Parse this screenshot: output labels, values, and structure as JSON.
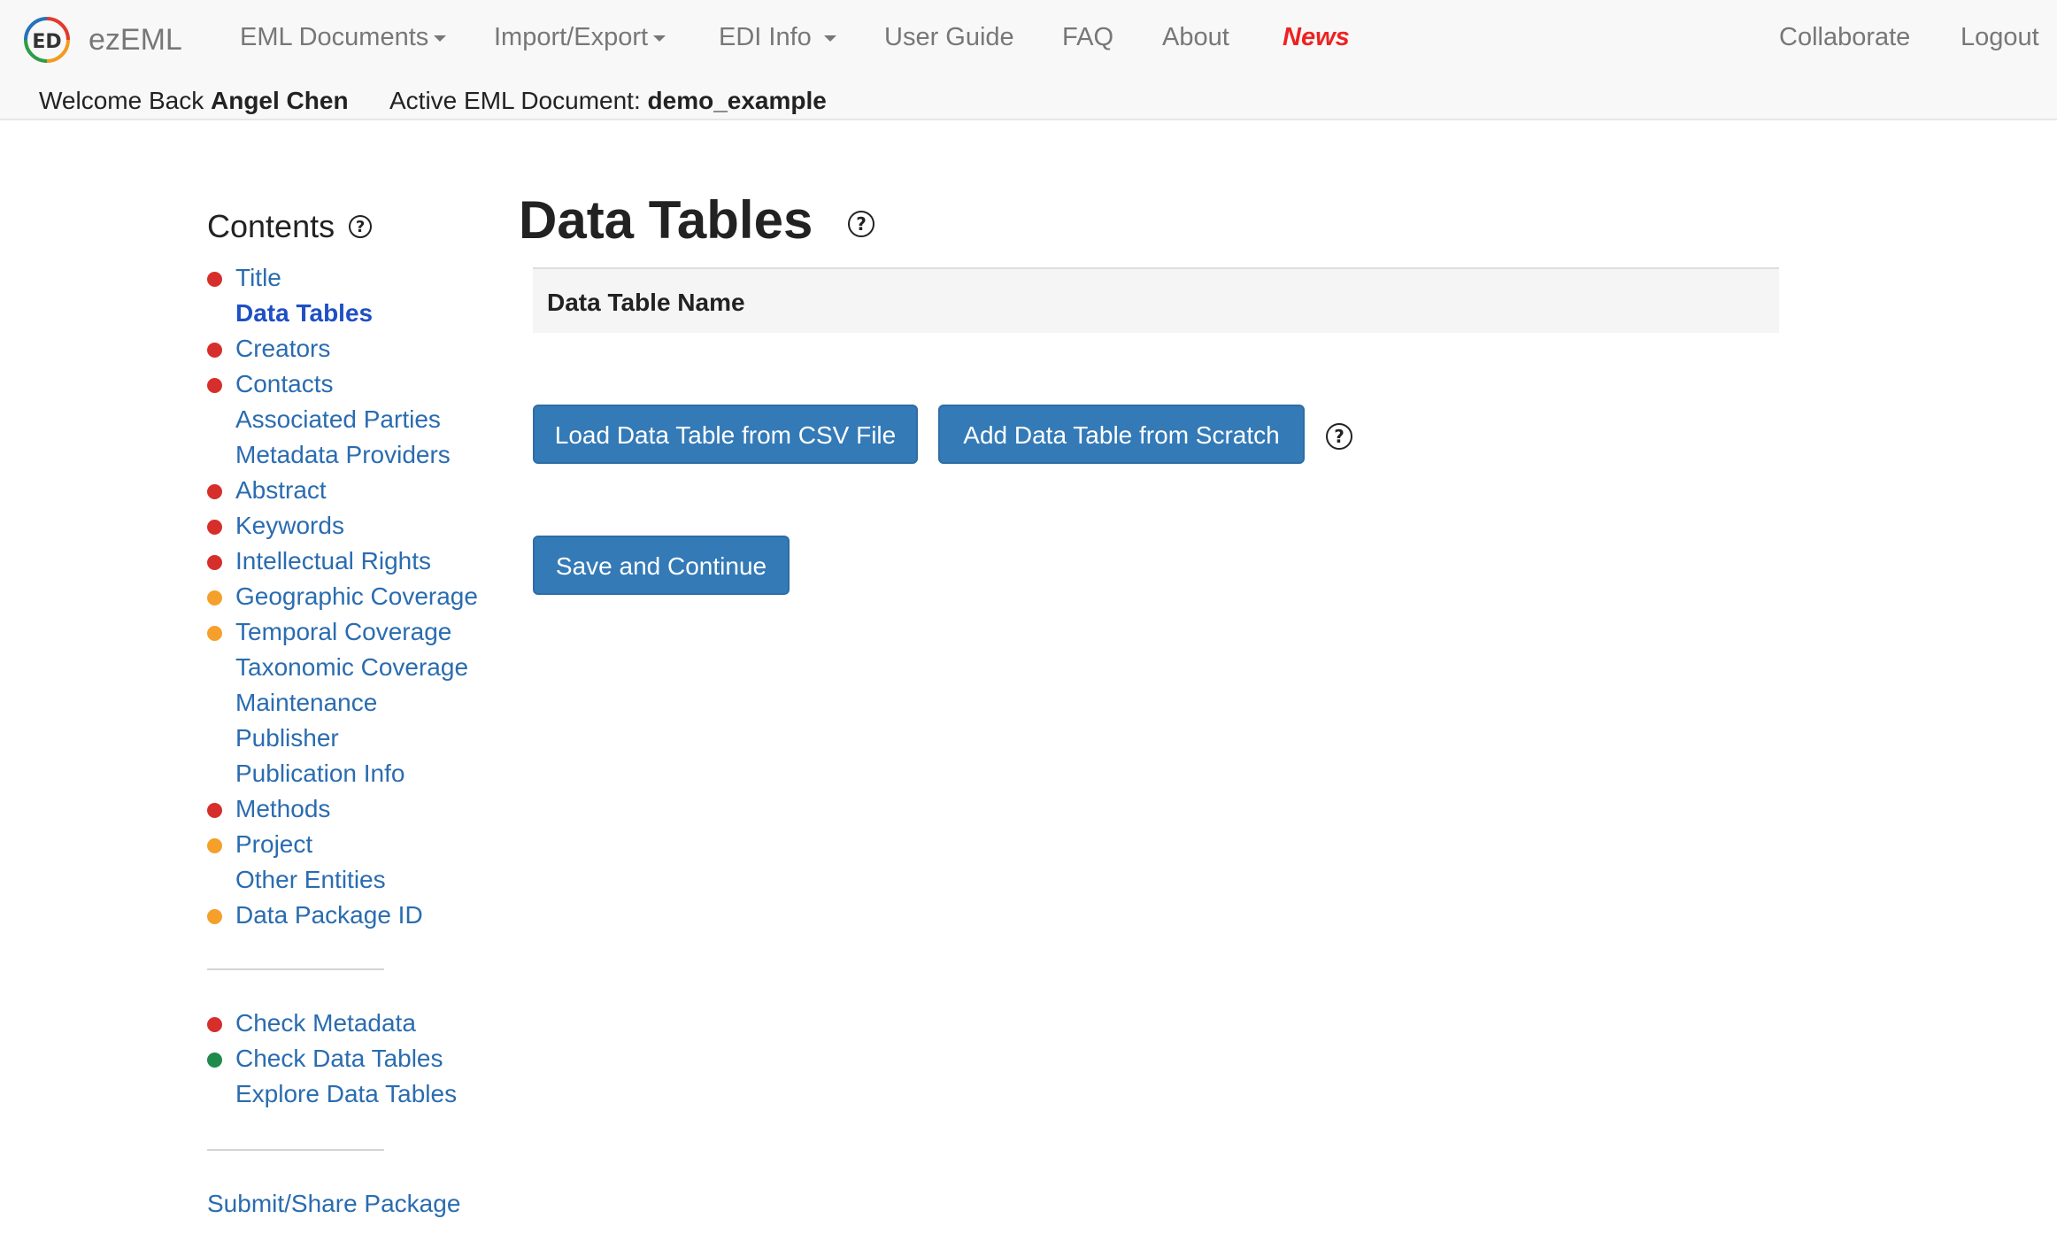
{
  "nav": {
    "brand": "ezEML",
    "items": [
      {
        "label": "EML Documents",
        "dropdown": true
      },
      {
        "label": "Import/Export",
        "dropdown": true
      },
      {
        "label": "EDI Info",
        "dropdown": true
      },
      {
        "label": "User Guide",
        "dropdown": false
      },
      {
        "label": "FAQ",
        "dropdown": false
      },
      {
        "label": "About",
        "dropdown": false
      },
      {
        "label": "News",
        "dropdown": false
      }
    ],
    "right_items": [
      {
        "label": "Collaborate"
      },
      {
        "label": "Logout"
      }
    ]
  },
  "subbar": {
    "welcome_prefix": "Welcome Back",
    "user_name": "Angel Chen",
    "doc_prefix": "Active EML Document:",
    "doc_name": "demo_example"
  },
  "sidebar": {
    "title": "Contents",
    "help_glyph": "?",
    "items": [
      {
        "label": "Title",
        "status": "red",
        "active": false
      },
      {
        "label": "Data Tables",
        "status": "none",
        "active": true
      },
      {
        "label": "Creators",
        "status": "red",
        "active": false
      },
      {
        "label": "Contacts",
        "status": "red",
        "active": false
      },
      {
        "label": "Associated Parties",
        "status": "none",
        "active": false
      },
      {
        "label": "Metadata Providers",
        "status": "none",
        "active": false
      },
      {
        "label": "Abstract",
        "status": "red",
        "active": false
      },
      {
        "label": "Keywords",
        "status": "red",
        "active": false
      },
      {
        "label": "Intellectual Rights",
        "status": "red",
        "active": false
      },
      {
        "label": "Geographic Coverage",
        "status": "orange",
        "active": false
      },
      {
        "label": "Temporal Coverage",
        "status": "orange",
        "active": false
      },
      {
        "label": "Taxonomic Coverage",
        "status": "none",
        "active": false
      },
      {
        "label": "Maintenance",
        "status": "none",
        "active": false
      },
      {
        "label": "Publisher",
        "status": "none",
        "active": false
      },
      {
        "label": "Publication Info",
        "status": "none",
        "active": false
      },
      {
        "label": "Methods",
        "status": "red",
        "active": false
      },
      {
        "label": "Project",
        "status": "orange",
        "active": false
      },
      {
        "label": "Other Entities",
        "status": "none",
        "active": false
      },
      {
        "label": "Data Package ID",
        "status": "orange",
        "active": false
      }
    ],
    "check_items": [
      {
        "label": "Check Metadata",
        "status": "red"
      },
      {
        "label": "Check Data Tables",
        "status": "green"
      },
      {
        "label": "Explore Data Tables",
        "status": "none"
      }
    ],
    "submit_label": "Submit/Share Package"
  },
  "colors": {
    "red": "#d62f2b",
    "orange": "#f5a02a",
    "green": "#1f8a4c",
    "link": "#2a6cb0",
    "button": "#337ab7",
    "news": "#ee2222"
  },
  "main": {
    "title": "Data Tables",
    "table_header": "Data Table Name",
    "load_button": "Load Data Table from CSV File",
    "add_button": "Add Data Table from Scratch",
    "save_button": "Save and Continue"
  }
}
